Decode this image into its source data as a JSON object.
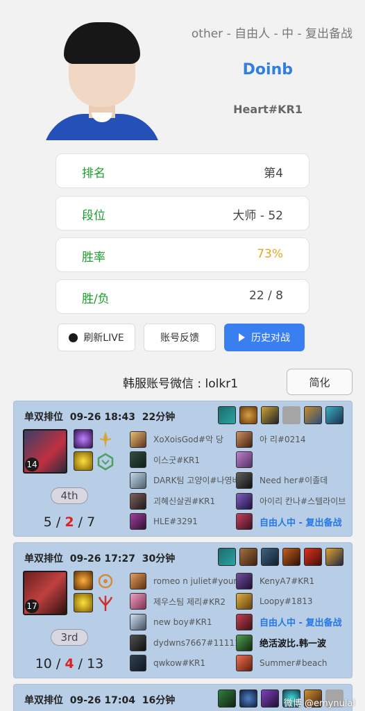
{
  "profile": {
    "team_line": "other - 自由人 - 中 - 复出备战",
    "player_name": "Doinb",
    "account_tag": "Heart#KR1"
  },
  "stats": [
    {
      "label": "排名",
      "value": "第4"
    },
    {
      "label": "段位",
      "value": "大师 - 52"
    },
    {
      "label": "胜率",
      "value": "73%"
    },
    {
      "label": "胜/负",
      "value": "22 / 8"
    }
  ],
  "buttons": {
    "refresh": "刷新LIVE",
    "feedback": "账号反馈",
    "history": "历史对战",
    "simplify": "简化"
  },
  "wechat_line": "韩服账号微信 : lolkr1",
  "matches": [
    {
      "mode": "单双排位",
      "time": "09-26 18:43",
      "duration": "22分钟",
      "level": "14",
      "place": "4th",
      "kda": {
        "k": "5",
        "d": "2",
        "a": "7"
      },
      "team_a": [
        "XoXoisGod#악 당",
        "이스굿#KR1",
        "DARK팀 고양이#나영바",
        "괴혜신살권#KR1",
        "HLE#3291"
      ],
      "team_b": [
        "아 리#0214",
        "",
        "Need her#이졸데",
        "아이리 칸나#스텔라이브",
        "自由人中 - 复出备战"
      ]
    },
    {
      "mode": "单双排位",
      "time": "09-26 17:27",
      "duration": "30分钟",
      "level": "17",
      "place": "3rd",
      "kda": {
        "k": "10",
        "d": "4",
        "a": "13"
      },
      "team_a": [
        "romeo n juliet#youra",
        "제우스팀 제리#KR2",
        "new boy#KR1",
        "dydwns7667#11111",
        "qwkow#KR1"
      ],
      "team_b": [
        "KenyA7#KR1",
        "Loopy#1813",
        "自由人中 - 复出备战",
        "绝活波比.韩一波",
        "Summer#beach"
      ]
    },
    {
      "mode": "单双排位",
      "time": "09-26 17:04",
      "duration": "16分钟"
    }
  ],
  "colors": {
    "accent_blue": "#3a7ff0",
    "win_green": "#1aa02a",
    "winrate_orange": "#e8a520",
    "death_red": "#e02020",
    "card_bg": "#b7cee6"
  },
  "watermark": "微博 @emynulal"
}
